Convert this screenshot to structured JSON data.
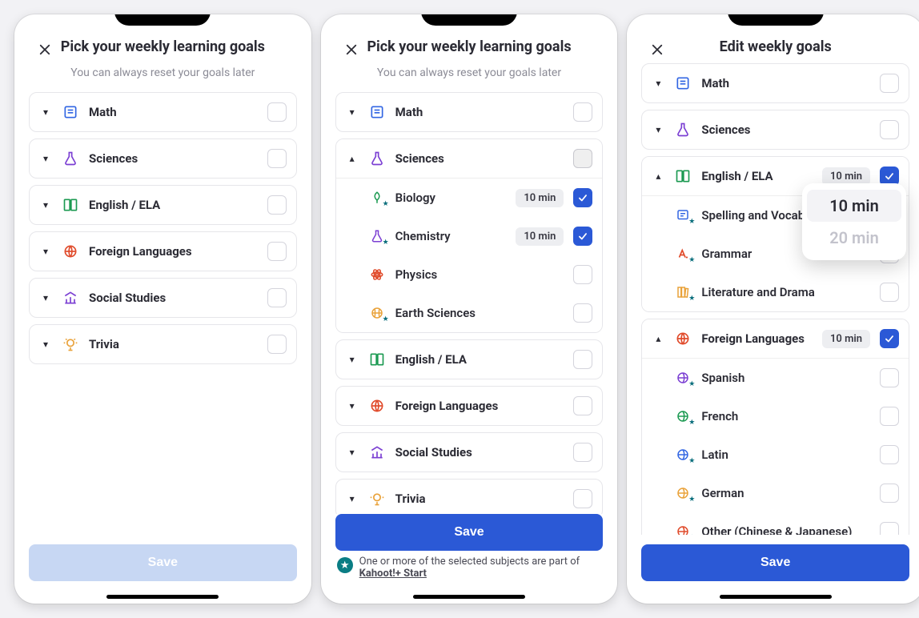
{
  "screens": {
    "a": {
      "title": "Pick your weekly learning goals",
      "subtitle": "You can always reset your goals later",
      "save": "Save"
    },
    "b": {
      "title": "Pick your weekly learning goals",
      "subtitle": "You can always reset your goals later",
      "save": "Save",
      "note_prefix": "One or more of the selected subjects are part of ",
      "note_link": "Kahoot!+ Start"
    },
    "c": {
      "title": "Edit weekly goals",
      "save": "Save"
    }
  },
  "subjects": {
    "math": "Math",
    "sciences": "Sciences",
    "english": "English / ELA",
    "foreign": "Foreign Languages",
    "social": "Social Studies",
    "trivia": "Trivia"
  },
  "subtopics": {
    "biology": "Biology",
    "chemistry": "Chemistry",
    "physics": "Physics",
    "earth": "Earth Sciences",
    "spelling": "Spelling and Vocabulary",
    "grammar": "Grammar",
    "literature": "Literature and Drama",
    "spanish": "Spanish",
    "french": "French",
    "latin": "Latin",
    "german": "German",
    "other_lang": "Other (Chinese & Japanese)"
  },
  "durations": {
    "ten": "10 min",
    "twenty": "20 min"
  },
  "picker": {
    "opt1": "10 min",
    "opt2": "20 min"
  }
}
